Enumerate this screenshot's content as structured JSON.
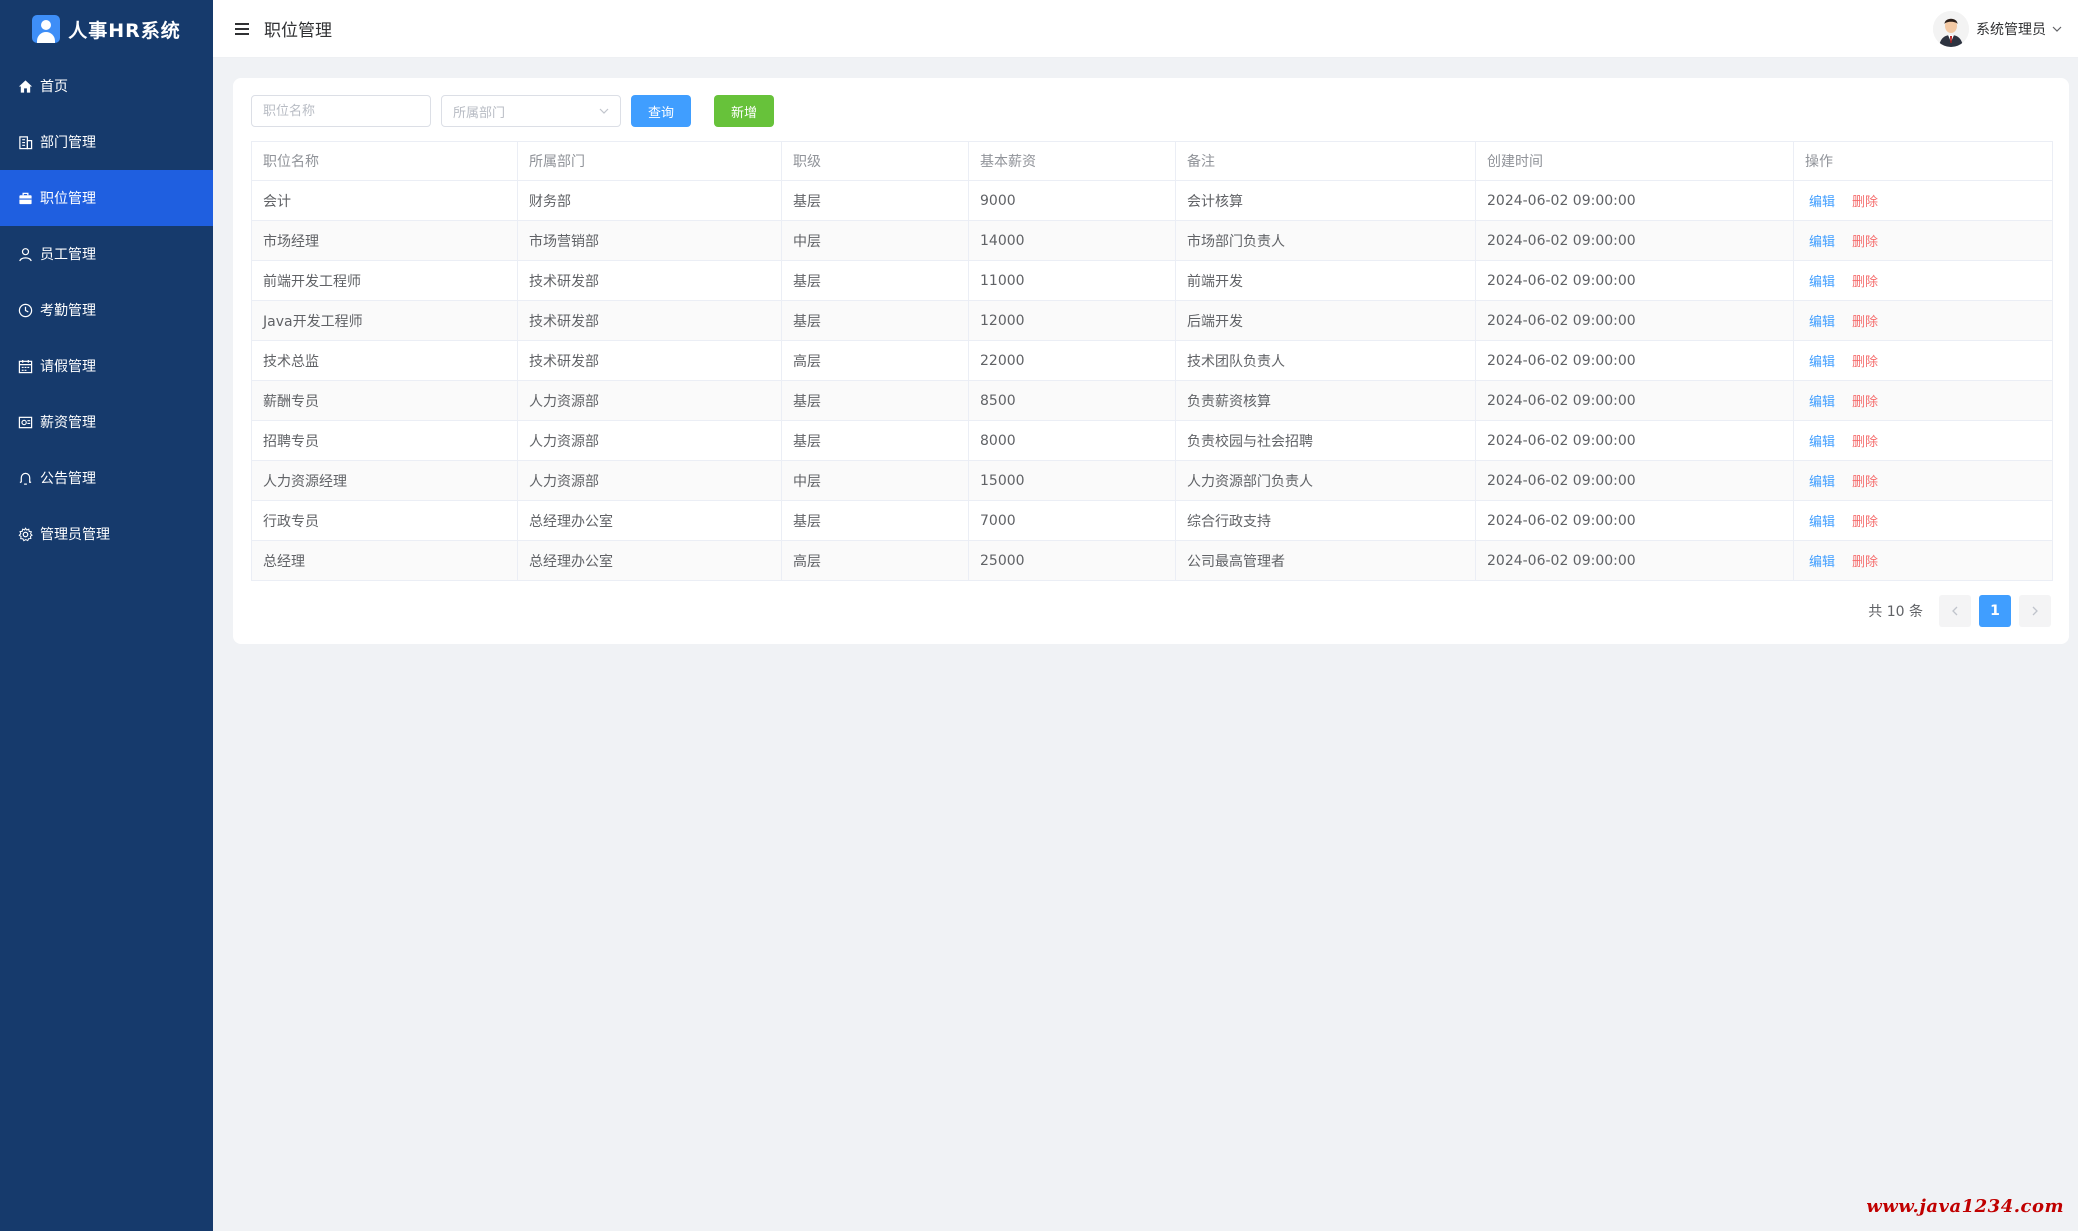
{
  "app": {
    "title": "人事HR系统"
  },
  "sidebar": {
    "items": [
      {
        "label": "首页",
        "icon": "home-icon",
        "active": false
      },
      {
        "label": "部门管理",
        "icon": "building-icon",
        "active": false
      },
      {
        "label": "职位管理",
        "icon": "briefcase-icon",
        "active": true
      },
      {
        "label": "员工管理",
        "icon": "user-icon",
        "active": false
      },
      {
        "label": "考勤管理",
        "icon": "clock-icon",
        "active": false
      },
      {
        "label": "请假管理",
        "icon": "calendar-icon",
        "active": false
      },
      {
        "label": "薪资管理",
        "icon": "wallet-icon",
        "active": false
      },
      {
        "label": "公告管理",
        "icon": "bell-icon",
        "active": false
      },
      {
        "label": "管理员管理",
        "icon": "gear-icon",
        "active": false
      }
    ]
  },
  "header": {
    "title": "职位管理",
    "user_name": "系统管理员"
  },
  "toolbar": {
    "name_placeholder": "职位名称",
    "dept_placeholder": "所属部门",
    "search_label": "查询",
    "add_label": "新增"
  },
  "table": {
    "columns": [
      "职位名称",
      "所属部门",
      "职级",
      "基本薪资",
      "备注",
      "创建时间",
      "操作"
    ],
    "edit_label": "编辑",
    "delete_label": "删除",
    "rows": [
      [
        "会计",
        "财务部",
        "基层",
        "9000",
        "会计核算",
        "2024-06-02 09:00:00"
      ],
      [
        "市场经理",
        "市场营销部",
        "中层",
        "14000",
        "市场部门负责人",
        "2024-06-02 09:00:00"
      ],
      [
        "前端开发工程师",
        "技术研发部",
        "基层",
        "11000",
        "前端开发",
        "2024-06-02 09:00:00"
      ],
      [
        "Java开发工程师",
        "技术研发部",
        "基层",
        "12000",
        "后端开发",
        "2024-06-02 09:00:00"
      ],
      [
        "技术总监",
        "技术研发部",
        "高层",
        "22000",
        "技术团队负责人",
        "2024-06-02 09:00:00"
      ],
      [
        "薪酬专员",
        "人力资源部",
        "基层",
        "8500",
        "负责薪资核算",
        "2024-06-02 09:00:00"
      ],
      [
        "招聘专员",
        "人力资源部",
        "基层",
        "8000",
        "负责校园与社会招聘",
        "2024-06-02 09:00:00"
      ],
      [
        "人力资源经理",
        "人力资源部",
        "中层",
        "15000",
        "人力资源部门负责人",
        "2024-06-02 09:00:00"
      ],
      [
        "行政专员",
        "总经理办公室",
        "基层",
        "7000",
        "综合行政支持",
        "2024-06-02 09:00:00"
      ],
      [
        "总经理",
        "总经理办公室",
        "高层",
        "25000",
        "公司最高管理者",
        "2024-06-02 09:00:00"
      ]
    ]
  },
  "pagination": {
    "total_label": "共 10 条",
    "current_page": "1"
  },
  "watermark": "www.java1234.com",
  "colors": {
    "sidebar_bg": "#163a6c",
    "active_item": "#1f5fe0",
    "primary": "#409eff",
    "success": "#67c23a",
    "danger": "#f56c6c"
  }
}
